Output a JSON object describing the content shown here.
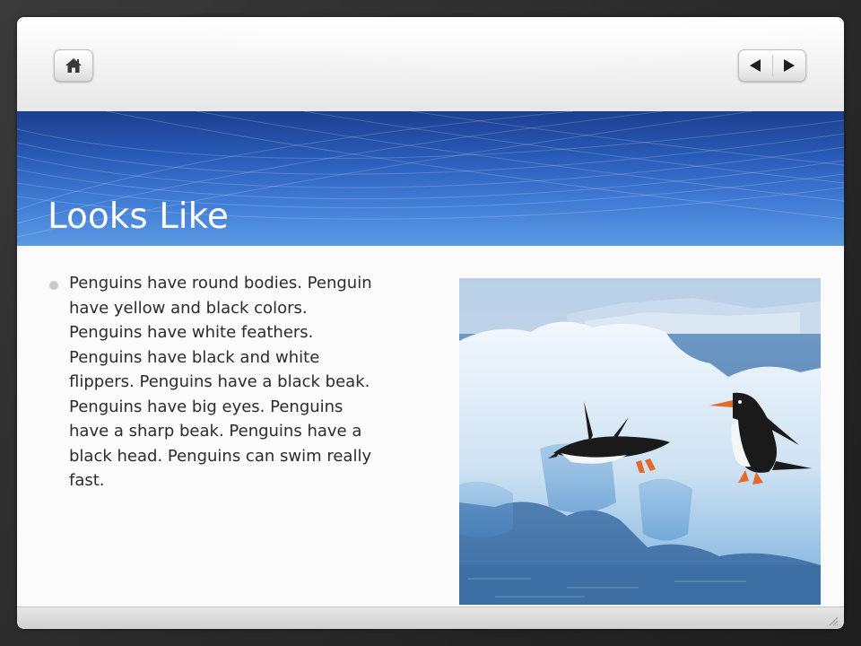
{
  "toolbar": {
    "home_icon": "home-icon",
    "prev_icon": "triangle-left-icon",
    "next_icon": "triangle-right-icon"
  },
  "slide": {
    "title": "Looks Like",
    "bullet": "Penguins have round bodies. Penguin have yellow and black colors. Penguins have white feathers. Penguins have black and white flippers. Penguins  have a black beak. Penguins have big eyes. Penguins have a sharp beak. Penguins have a black head. Penguins can swim really fast.",
    "image_subject": "penguins-on-ice-photo"
  },
  "colors": {
    "title_band_top": "#1c3f8f",
    "title_band_bottom": "#5a98e2",
    "title_text": "#ffffff",
    "body_text": "#2b2b2b"
  }
}
